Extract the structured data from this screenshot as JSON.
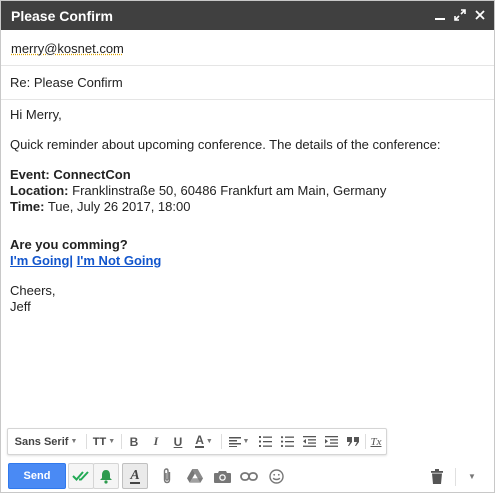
{
  "window": {
    "title": "Please Confirm"
  },
  "recipient": {
    "to": "merry@kosnet.com"
  },
  "subject": {
    "value": "Re: Please Confirm"
  },
  "body": {
    "greeting": "Hi Merry,",
    "intro": "Quick reminder about upcoming conference. The details of the conference:",
    "event_label": "Event:",
    "event_value": "ConnectCon",
    "location_label": "Location:",
    "location_value": "Franklinstraße 50, 60486 Frankfurt am Main, Germany",
    "time_label": "Time:",
    "time_value": "Tue, July 26 2017, 18:00",
    "question": "Are you comming?",
    "link_going": "I'm Going",
    "link_separator": "|",
    "link_not_going": "I'm Not Going",
    "signoff": "Cheers,",
    "signature": "Jeff"
  },
  "format_toolbar": {
    "font": "Sans Serif",
    "size_icon": "TT",
    "bold": "B",
    "italic": "I",
    "underline": "U",
    "text_color": "A",
    "clear_format": "Tx"
  },
  "bottom_bar": {
    "send_label": "Send",
    "formatting_label": "A"
  },
  "colors": {
    "titlebar": "#404040",
    "send_button": "#4a8af4",
    "link": "#1155cc",
    "check_green": "#22aa55",
    "bell_green": "#2e9b4e"
  }
}
